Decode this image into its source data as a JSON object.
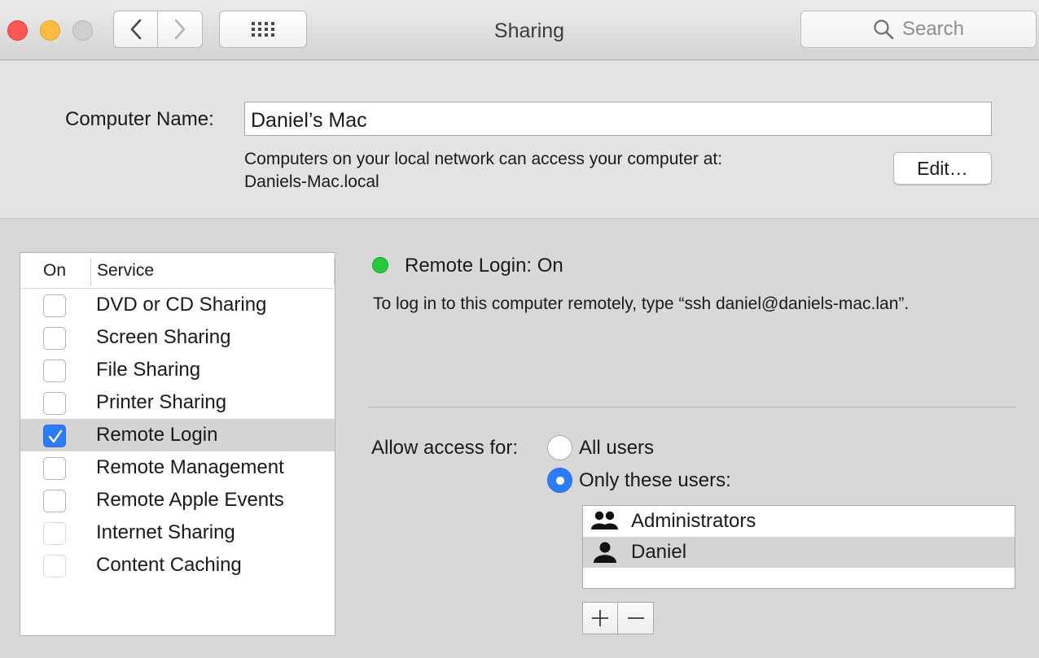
{
  "window": {
    "title": "Sharing"
  },
  "toolbar": {
    "search_placeholder": "Search"
  },
  "computer_name": {
    "label": "Computer Name:",
    "value": "Daniel’s Mac",
    "description_line1": "Computers on your local network can access your computer at:",
    "description_line2": "Daniels-Mac.local",
    "edit_label": "Edit…"
  },
  "services": {
    "col_on": "On",
    "col_service": "Service",
    "items": [
      {
        "label": "DVD or CD Sharing",
        "checked": false,
        "enabled": true
      },
      {
        "label": "Screen Sharing",
        "checked": false,
        "enabled": true
      },
      {
        "label": "File Sharing",
        "checked": false,
        "enabled": true
      },
      {
        "label": "Printer Sharing",
        "checked": false,
        "enabled": true
      },
      {
        "label": "Remote Login",
        "checked": true,
        "enabled": true,
        "selected": true
      },
      {
        "label": "Remote Management",
        "checked": false,
        "enabled": true
      },
      {
        "label": "Remote Apple Events",
        "checked": false,
        "enabled": true
      },
      {
        "label": "Internet Sharing",
        "checked": false,
        "enabled": false
      },
      {
        "label": "Content Caching",
        "checked": false,
        "enabled": false
      }
    ]
  },
  "detail": {
    "status": "Remote Login: On",
    "status_color": "#27c93f",
    "info": "To log in to this computer remotely, type “ssh daniel@daniels-mac.lan”.",
    "access_label": "Allow access for:",
    "option_all": "All users",
    "option_only": "Only these users:",
    "selected_option": "only",
    "users": [
      {
        "name": "Administrators",
        "icon": "group-icon"
      },
      {
        "name": "Daniel",
        "icon": "person-icon",
        "selected": true
      }
    ]
  },
  "colors": {
    "accent": "#2d7cf6",
    "close": "#fc5753",
    "minimize": "#fdbc40"
  }
}
